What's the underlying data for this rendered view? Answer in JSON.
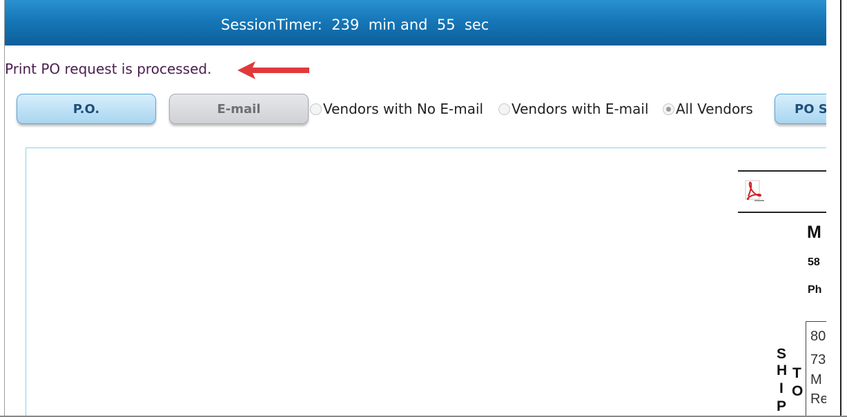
{
  "session": {
    "label": "SessionTimer:",
    "minutes": "239",
    "min_unit": "min and",
    "seconds": "55",
    "sec_unit": "sec"
  },
  "status_message": "Print PO request is processed.",
  "toolbar": {
    "po_label": "P.O.",
    "email_label": "E-mail",
    "po_s_label": "PO S"
  },
  "vendor_filter": {
    "options": [
      "Vendors with No E-mail",
      "Vendors with E-mail",
      "All Vendors"
    ],
    "selected": "All Vendors"
  },
  "document_preview": {
    "heading_fragment": "M",
    "line1_fragment": "58",
    "line2_fragment": "Ph",
    "ship_to_letters_col1": [
      "S",
      "H",
      "I",
      "P"
    ],
    "ship_to_letters_col2": [
      "T",
      "O"
    ],
    "address_fragments": [
      "80",
      "73",
      "M",
      "Re"
    ]
  },
  "icons": {
    "pdf": "pdf-icon",
    "arrow": "red-arrow-annotation"
  },
  "colors": {
    "session_bar": "#1677b8",
    "arrow": "#e0393c",
    "status_text": "#4a1d4d"
  }
}
